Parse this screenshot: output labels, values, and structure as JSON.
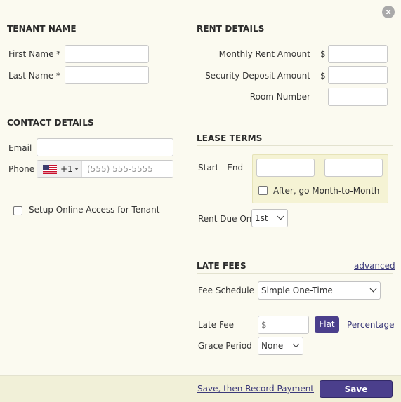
{
  "close_label": "x",
  "tenant_name": {
    "title": "TENANT NAME",
    "first_name_label": "First Name *",
    "last_name_label": "Last Name *",
    "first_name_value": "",
    "last_name_value": ""
  },
  "contact": {
    "title": "CONTACT DETAILS",
    "email_label": "Email",
    "email_value": "",
    "phone_label": "Phone",
    "country_code": "+1",
    "phone_placeholder": "(555) 555-5555",
    "online_access_label": "Setup Online Access for Tenant"
  },
  "rent": {
    "title": "RENT DETAILS",
    "monthly_rent_label": "Monthly Rent Amount",
    "security_deposit_label": "Security Deposit Amount",
    "room_number_label": "Room Number",
    "currency_symbol": "$"
  },
  "lease": {
    "title": "LEASE TERMS",
    "start_end_label": "Start - End",
    "separator": "-",
    "month_to_month_label": "After, go Month-to-Month",
    "rent_due_label": "Rent Due On",
    "rent_due_value": "1st"
  },
  "late_fees": {
    "title": "LATE FEES",
    "advanced_link": "advanced",
    "fee_schedule_label": "Fee Schedule",
    "fee_schedule_value": "Simple One-Time",
    "late_fee_label": "Late Fee",
    "late_fee_placeholder": "$",
    "flat_label": "Flat",
    "percentage_label": "Percentage",
    "grace_period_label": "Grace Period",
    "grace_period_value": "None"
  },
  "footer": {
    "save_then_record_label": "Save, then Record Payment",
    "save_label": "Save"
  },
  "colors": {
    "background": "#fbfaf0",
    "primary_button": "#4b3f8c",
    "highlight_box": "#f5f3d4"
  }
}
